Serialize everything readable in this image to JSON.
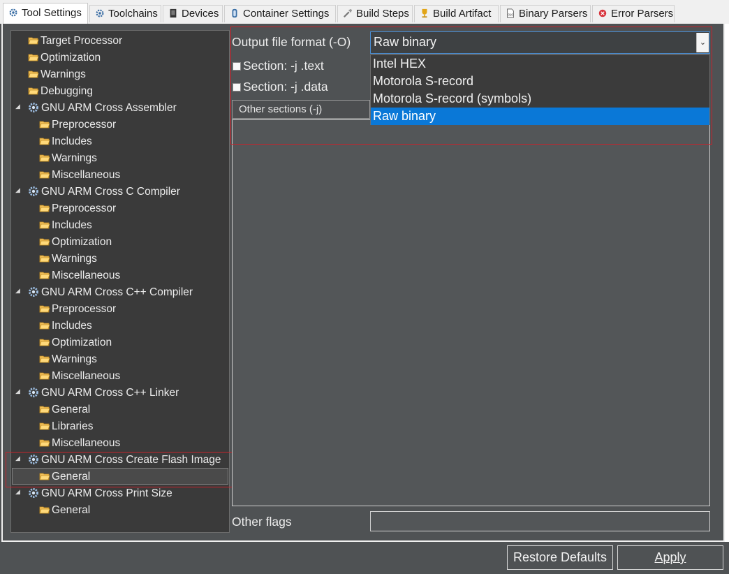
{
  "tabs": [
    {
      "label": "Tool Settings",
      "icon": "tool-settings-icon",
      "active": true
    },
    {
      "label": "Toolchains",
      "icon": "toolchains-icon"
    },
    {
      "label": "Devices",
      "icon": "devices-icon"
    },
    {
      "label": "Container Settings",
      "icon": "container-icon"
    },
    {
      "label": "Build Steps",
      "icon": "build-steps-icon"
    },
    {
      "label": "Build Artifact",
      "icon": "trophy-icon"
    },
    {
      "label": "Binary Parsers",
      "icon": "binary-icon"
    },
    {
      "label": "Error Parsers",
      "icon": "error-icon"
    }
  ],
  "tree": [
    {
      "label": "Target Processor",
      "level": 1,
      "type": "folder"
    },
    {
      "label": "Optimization",
      "level": 1,
      "type": "folder"
    },
    {
      "label": "Warnings",
      "level": 1,
      "type": "folder"
    },
    {
      "label": "Debugging",
      "level": 1,
      "type": "folder"
    },
    {
      "label": "GNU ARM Cross Assembler",
      "level": 0,
      "type": "tool"
    },
    {
      "label": "Preprocessor",
      "level": 2,
      "type": "folder"
    },
    {
      "label": "Includes",
      "level": 2,
      "type": "folder"
    },
    {
      "label": "Warnings",
      "level": 2,
      "type": "folder"
    },
    {
      "label": "Miscellaneous",
      "level": 2,
      "type": "folder"
    },
    {
      "label": "GNU ARM Cross C Compiler",
      "level": 0,
      "type": "tool"
    },
    {
      "label": "Preprocessor",
      "level": 2,
      "type": "folder"
    },
    {
      "label": "Includes",
      "level": 2,
      "type": "folder"
    },
    {
      "label": "Optimization",
      "level": 2,
      "type": "folder"
    },
    {
      "label": "Warnings",
      "level": 2,
      "type": "folder"
    },
    {
      "label": "Miscellaneous",
      "level": 2,
      "type": "folder"
    },
    {
      "label": "GNU ARM Cross C++ Compiler",
      "level": 0,
      "type": "tool"
    },
    {
      "label": "Preprocessor",
      "level": 2,
      "type": "folder"
    },
    {
      "label": "Includes",
      "level": 2,
      "type": "folder"
    },
    {
      "label": "Optimization",
      "level": 2,
      "type": "folder"
    },
    {
      "label": "Warnings",
      "level": 2,
      "type": "folder"
    },
    {
      "label": "Miscellaneous",
      "level": 2,
      "type": "folder"
    },
    {
      "label": "GNU ARM Cross C++ Linker",
      "level": 0,
      "type": "tool"
    },
    {
      "label": "General",
      "level": 2,
      "type": "folder"
    },
    {
      "label": "Libraries",
      "level": 2,
      "type": "folder"
    },
    {
      "label": "Miscellaneous",
      "level": 2,
      "type": "folder"
    },
    {
      "label": "GNU ARM Cross Create Flash Image",
      "level": 0,
      "type": "tool"
    },
    {
      "label": "General",
      "level": 2,
      "type": "folder",
      "selected": true
    },
    {
      "label": "GNU ARM Cross Print Size",
      "level": 0,
      "type": "tool"
    },
    {
      "label": "General",
      "level": 2,
      "type": "folder"
    }
  ],
  "output_format": {
    "label": "Output file format (-O)",
    "value": "Raw binary",
    "options": [
      "Intel HEX",
      "Motorola S-record",
      "Motorola S-record (symbols)",
      "Raw binary"
    ],
    "selected_index": 3
  },
  "section_text": {
    "label": "Section: -j .text",
    "checked": false
  },
  "section_data": {
    "label": "Section: -j .data",
    "checked": false
  },
  "other_sections": {
    "label": "Other sections (-j)"
  },
  "other_flags": {
    "label": "Other flags",
    "value": ""
  },
  "buttons": {
    "restore": "Restore Defaults",
    "apply": "Apply"
  },
  "colors": {
    "selection": "#0a78d7",
    "highlight_box": "#c8232c",
    "panel_bg": "#4f5254",
    "tree_bg": "#3a3a3a"
  }
}
